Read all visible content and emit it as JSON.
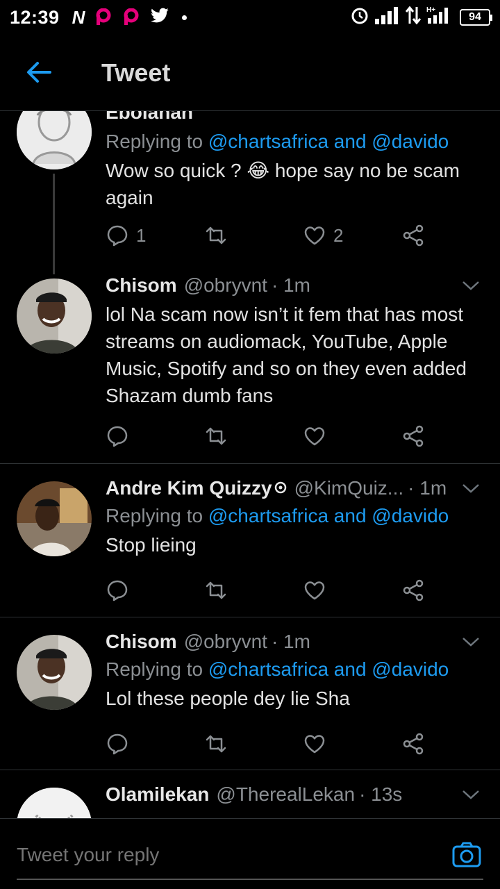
{
  "status_bar": {
    "time": "12:39",
    "battery": "94",
    "left_icons": [
      "n-icon",
      "p-icon",
      "p-icon",
      "twitter-bird-icon",
      "dot-icon"
    ],
    "right_icons": [
      "alarm-icon",
      "signal-icon",
      "data-arrows-icon",
      "hplus-signal-icon",
      "battery-icon"
    ]
  },
  "header": {
    "title": "Tweet",
    "back_icon": "back-arrow-icon"
  },
  "tweets": [
    {
      "name": "Ebolahan",
      "replying_prefix": "Replying to",
      "mentions": "@chartsafrica and @davido",
      "text": "Wow so quick ? 😂 hope say no be scam again",
      "reply_count": "1",
      "retweet_count": "",
      "like_count": "2"
    },
    {
      "name": "Chisom",
      "handle": "@obryvnt",
      "time": "· 1m",
      "text": "lol Na scam now isn’t it fem that has most streams on audiomack, YouTube, Apple Music, Spotify and so on they even added Shazam dumb fans",
      "reply_count": "",
      "retweet_count": "",
      "like_count": ""
    },
    {
      "name": "Andre Kim Quizzy",
      "handle": "@KimQuiz...",
      "time": "· 1m",
      "replying_prefix": "Replying to",
      "mentions": "@chartsafrica and @davido",
      "text": "Stop lieing"
    },
    {
      "name": "Chisom",
      "handle": "@obryvnt",
      "time": "· 1m",
      "replying_prefix": "Replying to",
      "mentions": "@chartsafrica and @davido",
      "text": "Lol these people dey lie Sha"
    },
    {
      "name": "Olamilekan",
      "handle": "@TherealLekan",
      "time": "· 13s"
    }
  ],
  "composer": {
    "placeholder": "Tweet your reply",
    "camera_icon": "camera-icon"
  },
  "colors": {
    "accent": "#1d9bf0",
    "background": "#000000",
    "secondary_text": "#8b8f93"
  }
}
